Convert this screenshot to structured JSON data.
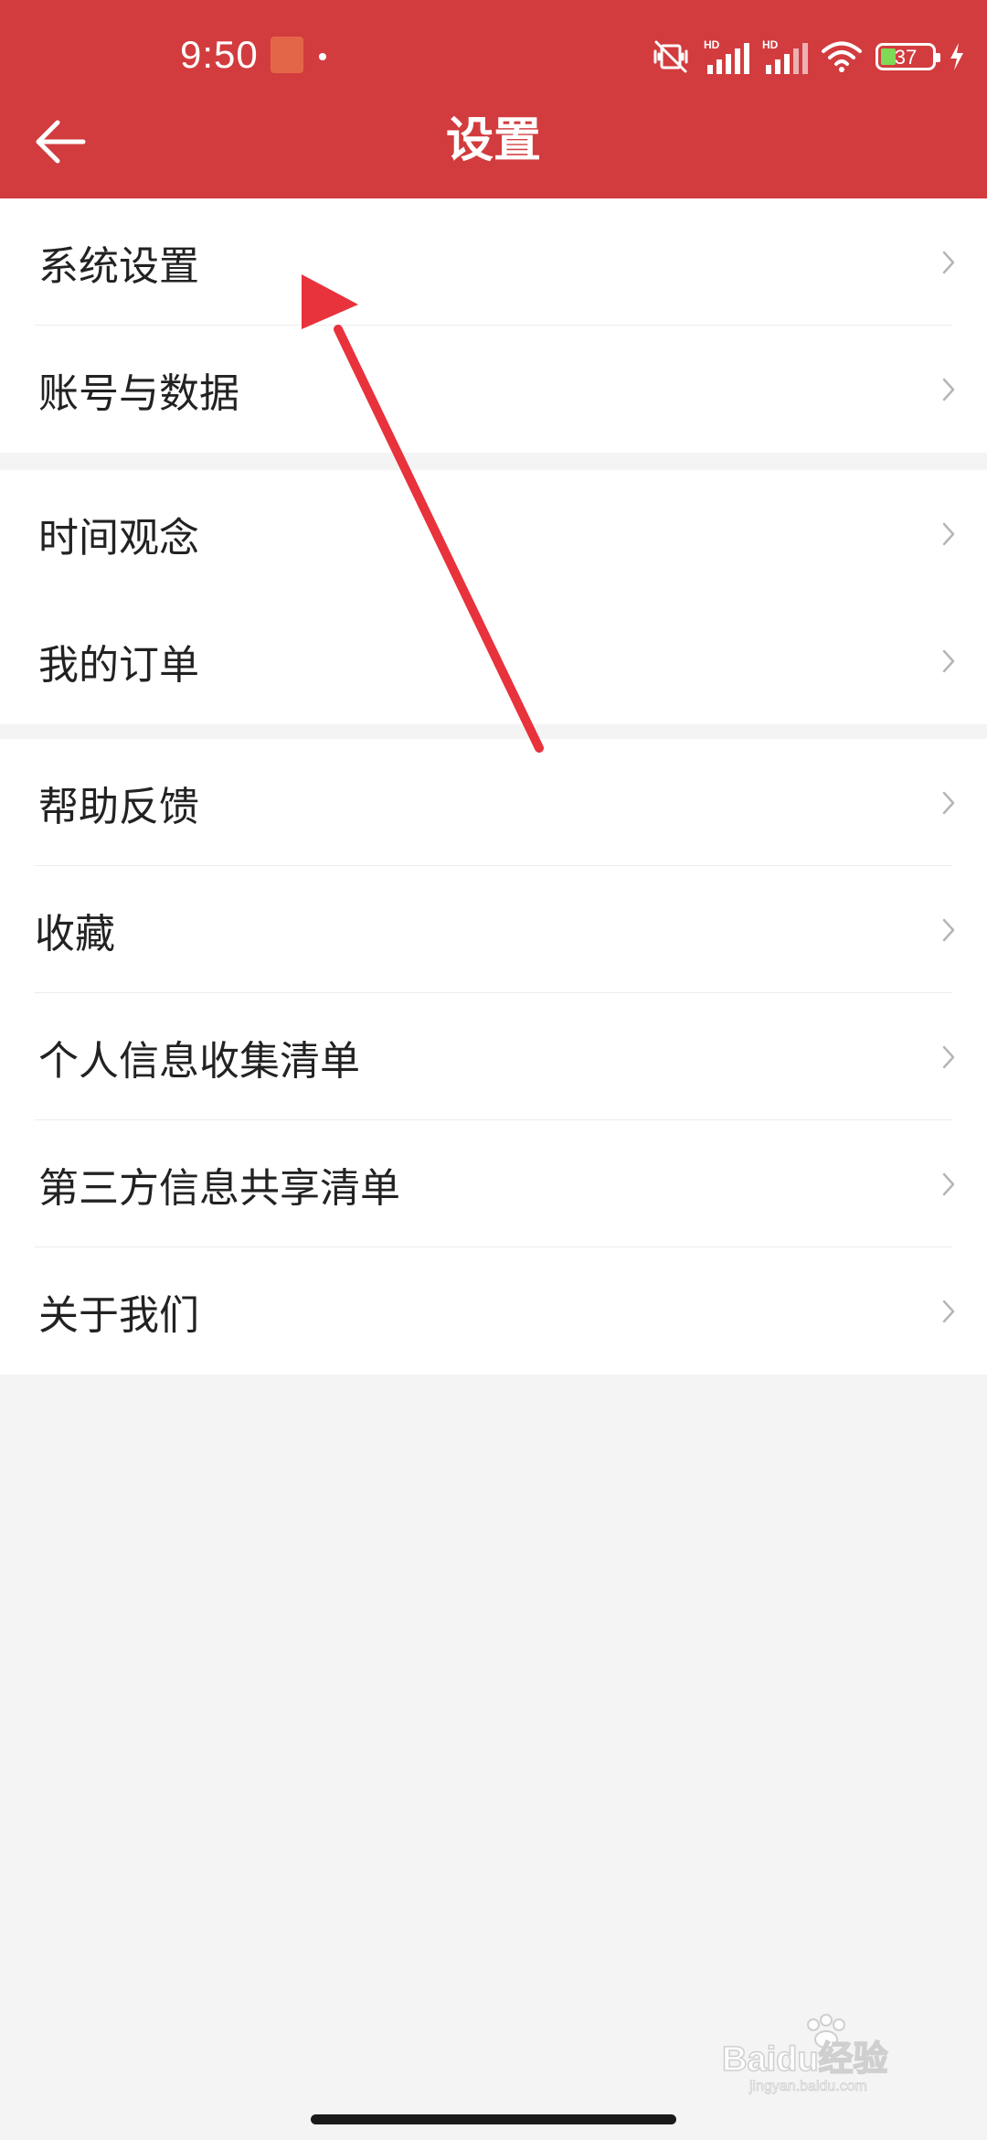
{
  "status_bar": {
    "time": "9:50",
    "battery_level": "37",
    "network_label_1": "HD",
    "network_label_2": "HD"
  },
  "header": {
    "title": "设置",
    "back_icon": "arrow-left-icon"
  },
  "settings_groups": [
    {
      "items": [
        {
          "label": "系统设置"
        },
        {
          "label": "账号与数据"
        }
      ]
    },
    {
      "items": [
        {
          "label": "时间观念"
        },
        {
          "label": "我的订单"
        }
      ]
    },
    {
      "items": [
        {
          "label": "帮助反馈"
        },
        {
          "label": "收藏"
        },
        {
          "label": "个人信息收集清单"
        },
        {
          "label": "第三方信息共享清单"
        },
        {
          "label": "关于我们"
        }
      ]
    }
  ],
  "watermark": {
    "brand": "Baidu经验",
    "url": "jingyan.baidu.com"
  },
  "colors": {
    "header_bg": "#d23c3e",
    "page_bg": "#f4f4f4",
    "row_bg": "#ffffff",
    "annotation_arrow": "#e8323c",
    "chevron": "#b5b5b5"
  }
}
